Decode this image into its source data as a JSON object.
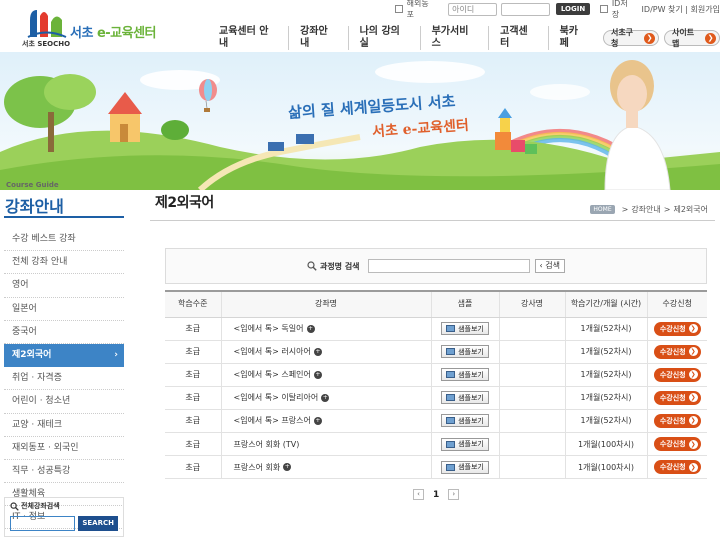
{
  "brand": {
    "logo_sub": "서초 SEOCHO",
    "logo_name_a": "서초",
    "logo_name_b": "e-교육센터"
  },
  "topbar": {
    "overseas_label": "해외동포",
    "id_placeholder": "아이디",
    "login_label": "LOGIN",
    "id_save_label": "ID저장",
    "find_label": "ID/PW 찾기",
    "join_label": "회원가입"
  },
  "gnb": {
    "items": [
      "교육센터 안내",
      "강좌안내",
      "나의 강의실",
      "부가서비스",
      "고객센터",
      "북카페"
    ],
    "seocho_gu_label": "서초구청",
    "sitemap_label": "사이트맵"
  },
  "banner": {
    "slogan_1": "삶의 질 세계일등도시 서초",
    "slogan_2": "서초 e-교육센터"
  },
  "sidebar": {
    "sub": "Course Guide",
    "title": "강좌안내",
    "items": [
      {
        "label": "수강 베스트 강좌"
      },
      {
        "label": "전체 강좌 안내"
      },
      {
        "label": "영어"
      },
      {
        "label": "일본어"
      },
      {
        "label": "중국어"
      },
      {
        "label": "제2외국어"
      },
      {
        "label": "취업 · 자격증"
      },
      {
        "label": "어린이 · 청소년"
      },
      {
        "label": "교양 · 재테크"
      },
      {
        "label": "재외동포 · 외국인"
      },
      {
        "label": "직무 · 성공특강"
      },
      {
        "label": "생활체육"
      },
      {
        "label": "IT · 정보"
      }
    ],
    "active_index": 5,
    "search_label": "전체강좌검색",
    "search_button": "SEARCH"
  },
  "content": {
    "title": "제2외국어",
    "breadcrumb_home": "HOME",
    "breadcrumb": [
      "강좌안내",
      "제2외국어"
    ],
    "search_label": "과정명 검색",
    "search_button": "검색",
    "columns": [
      "학습수준",
      "강좌명",
      "샘플",
      "강사명",
      "학습기간/개월 (시간)",
      "수강신청"
    ],
    "sample_label": "샘플보기",
    "apply_label": "수강신청",
    "rows": [
      {
        "level": "초급",
        "name": "<입에서 톡> 독일어",
        "instructor": "",
        "period": "1개월(52차시)"
      },
      {
        "level": "초급",
        "name": "<입에서 톡> 러시아어",
        "instructor": "",
        "period": "1개월(52차시)"
      },
      {
        "level": "초급",
        "name": "<입에서 톡> 스페인어",
        "instructor": "",
        "period": "1개월(52차시)"
      },
      {
        "level": "초급",
        "name": "<입에서 톡> 이탈리아어",
        "instructor": "",
        "period": "1개월(52차시)"
      },
      {
        "level": "초급",
        "name": "<입에서 톡> 프랑스어",
        "instructor": "",
        "period": "1개월(52차시)"
      },
      {
        "level": "초급",
        "name": "프랑스어 회화 (TV)",
        "instructor": "",
        "period": "1개월(100차시)"
      },
      {
        "level": "초급",
        "name": "프랑스어 회화",
        "instructor": "",
        "period": "1개월(100차시)"
      }
    ],
    "page_current": "1"
  }
}
